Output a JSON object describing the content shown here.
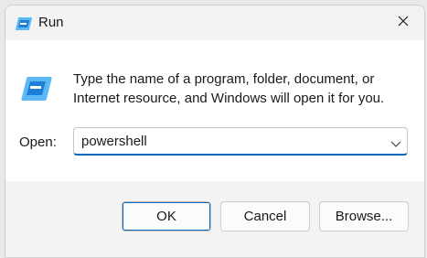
{
  "window": {
    "title": "Run",
    "title_icon": "run-icon",
    "close_icon": "close-icon"
  },
  "content": {
    "icon": "run-icon",
    "description": "Type the name of a program, folder, document, or Internet resource, and Windows will open it for you.",
    "open_label": "Open:",
    "open_value": "powershell",
    "dropdown_icon": "chevron-down-icon"
  },
  "buttons": {
    "ok_label": "OK",
    "cancel_label": "Cancel",
    "browse_label": "Browse..."
  },
  "colors": {
    "accent": "#0067c0",
    "icon_blue": "#2d8fe0"
  }
}
